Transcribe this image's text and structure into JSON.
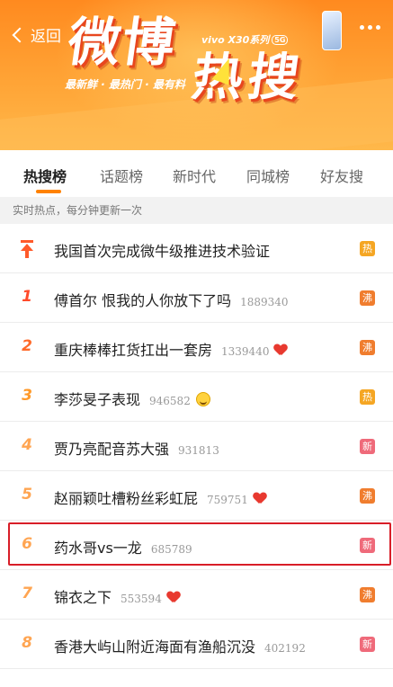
{
  "header": {
    "back_label": "返回",
    "logo_text": "微博",
    "logo_text2": "热搜",
    "slogan": "最新鲜 · 最热门 · 最有料",
    "sponsor": "vivo X30系列",
    "sponsor_badge": "5G"
  },
  "tabs": [
    {
      "label": "热搜榜",
      "active": true
    },
    {
      "label": "话题榜",
      "active": false
    },
    {
      "label": "新时代",
      "active": false
    },
    {
      "label": "同城榜",
      "active": false
    },
    {
      "label": "好友搜",
      "active": false
    }
  ],
  "notice": "实时热点，每分钟更新一次",
  "colors": {
    "hot": "#f5a623",
    "boil": "#f07d2e",
    "new": "#ef6a7a",
    "accent": "#ff8200",
    "highlight": "#d81e28"
  },
  "list": [
    {
      "rank": "",
      "pinned": true,
      "title": "我国首次完成微牛级推进技术验证",
      "count": "",
      "icon": "",
      "badge": "热",
      "badge_type": "hot"
    },
    {
      "rank": "1",
      "title": "傅首尔 恨我的人你放下了吗",
      "count": "1889340",
      "icon": "",
      "badge": "沸",
      "badge_type": "boil"
    },
    {
      "rank": "2",
      "title": "重庆棒棒扛货扛出一套房",
      "count": "1339440",
      "icon": "heart-icon",
      "badge": "沸",
      "badge_type": "boil"
    },
    {
      "rank": "3",
      "title": "李莎旻子表现",
      "count": "946582",
      "icon": "smile-emoji-icon",
      "badge": "热",
      "badge_type": "hot"
    },
    {
      "rank": "4",
      "title": "贾乃亮配音苏大强",
      "count": "931813",
      "icon": "",
      "badge": "新",
      "badge_type": "new"
    },
    {
      "rank": "5",
      "title": "赵丽颖吐槽粉丝彩虹屁",
      "count": "759751",
      "icon": "heart-icon",
      "badge": "沸",
      "badge_type": "boil"
    },
    {
      "rank": "6",
      "title": "药水哥vs一龙",
      "count": "685789",
      "icon": "",
      "badge": "新",
      "badge_type": "new"
    },
    {
      "rank": "7",
      "title": "锦衣之下",
      "count": "553594",
      "icon": "heart-icon",
      "badge": "沸",
      "badge_type": "boil"
    },
    {
      "rank": "8",
      "title": "香港大屿山附近海面有渔船沉没",
      "count": "402192",
      "icon": "",
      "badge": "新",
      "badge_type": "new"
    }
  ]
}
